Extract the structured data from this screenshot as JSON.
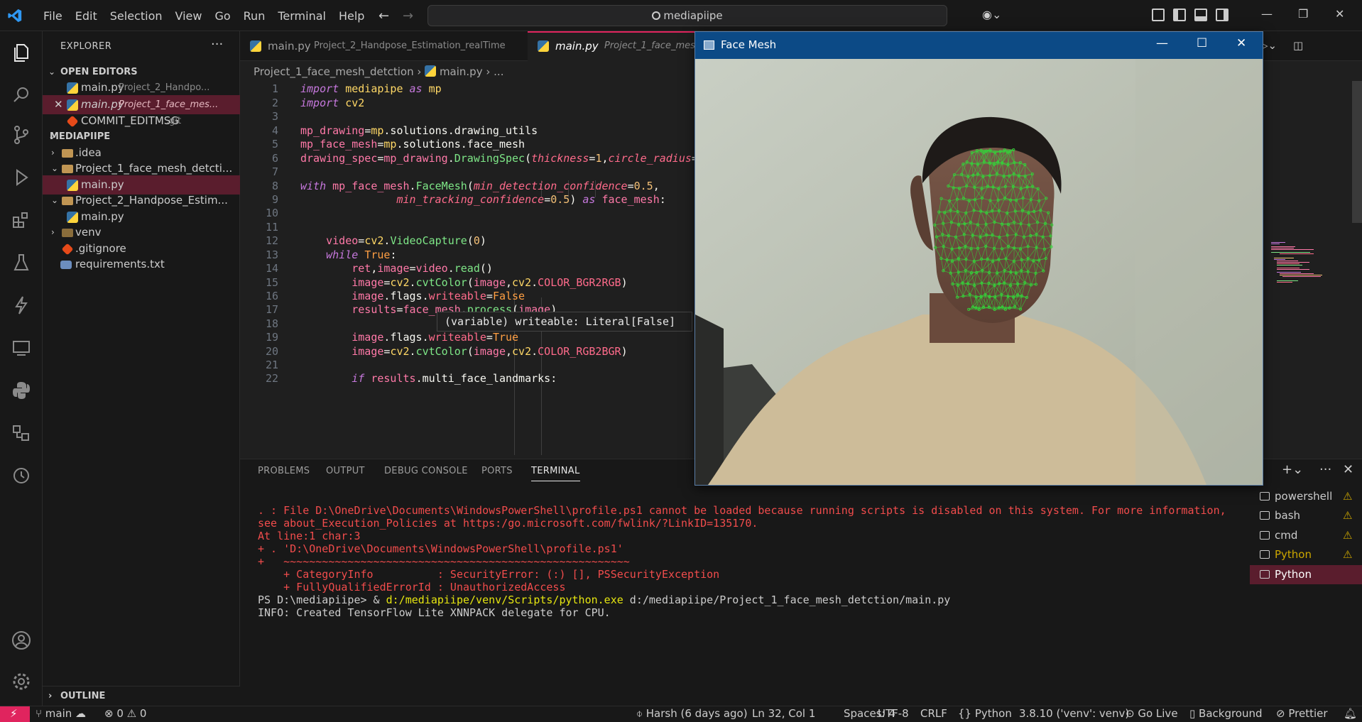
{
  "menu": [
    "File",
    "Edit",
    "Selection",
    "View",
    "Go",
    "Run",
    "Terminal",
    "Help"
  ],
  "search": {
    "text": "mediapiipe"
  },
  "sidebar": {
    "title": "EXPLORER",
    "open_editors_label": "OPEN EDITORS",
    "open_editors": [
      {
        "name": "main.py",
        "path": "Project_2_Handpo..."
      },
      {
        "name": "main.py",
        "path": "Project_1_face_mes..."
      },
      {
        "name": "COMMIT_EDITMSG",
        "path": ".git"
      }
    ],
    "workspace_label": "MEDIAPIIPE",
    "tree": [
      {
        "name": ".idea"
      },
      {
        "name": "Project_1_face_mesh_detcti..."
      },
      {
        "name": "main.py"
      },
      {
        "name": "Project_2_Handpose_Estim..."
      },
      {
        "name": "main.py"
      },
      {
        "name": "venv"
      },
      {
        "name": ".gitignore"
      },
      {
        "name": "requirements.txt"
      }
    ],
    "outline_label": "OUTLINE"
  },
  "tabs": [
    {
      "name": "main.py",
      "path": "Project_2_Handpose_Estimation_realTime"
    },
    {
      "name": "main.py",
      "path": "Project_1_face_mesh_"
    }
  ],
  "breadcrumb": {
    "folder": "Project_1_face_mesh_detction",
    "file": "main.py",
    "rest": "..."
  },
  "code": {
    "line_numbers": [
      "1",
      "2",
      "3",
      "4",
      "5",
      "6",
      "7",
      "8",
      "9",
      "10",
      "11",
      "12",
      "13",
      "14",
      "15",
      "16",
      "17",
      "18",
      "19",
      "20",
      "21",
      "22"
    ]
  },
  "hover": {
    "text": "(variable) writeable: Literal[False]"
  },
  "panel": {
    "tabs": [
      "PROBLEMS",
      "OUTPUT",
      "DEBUG CONSOLE",
      "PORTS",
      "TERMINAL"
    ],
    "terminal_lines": [
      ". : File D:\\OneDrive\\Documents\\WindowsPowerShell\\profile.ps1 cannot be loaded because running scripts is disabled on this system. For more information,",
      "see about_Execution_Policies at https:/go.microsoft.com/fwlink/?LinkID=135170.",
      "At line:1 char:3",
      "+ . 'D:\\OneDrive\\Documents\\WindowsPowerShell\\profile.ps1'",
      "+   ~~~~~~~~~~~~~~~~~~~~~~~~~~~~~~~~~~~~~~~~~~~~~~~~~~~~~~",
      "    + CategoryInfo          : SecurityError: (:) [], PSSecurityException",
      "    + FullyQualifiedErrorId : UnauthorizedAccess"
    ],
    "prompt": "PS D:\\mediapiipe> & ",
    "command_exe": "d:/mediapiipe/venv/Scripts/python.exe",
    "command_arg": " d:/mediapiipe/Project_1_face_mesh_detction/main.py",
    "info_line": "INFO: Created TensorFlow Lite XNNPACK delegate for CPU.",
    "terminals": [
      "powershell",
      "bash",
      "cmd",
      "Python",
      "Python"
    ]
  },
  "status": {
    "branch": "main",
    "errors": "0",
    "warnings": "0",
    "blame": "Harsh (6 days ago)",
    "position": "Ln 32, Col 1",
    "spaces": "Spaces: 4",
    "encoding": "UTF-8",
    "eol": "CRLF",
    "language": "Python",
    "interpreter": "3.8.10 ('venv': venv)",
    "golive": "Go Live",
    "background": "Background",
    "prettier": "Prettier"
  },
  "facemesh_window": {
    "title": "Face Mesh"
  },
  "colors": {
    "accent": "#e0245e",
    "selection": "#5a1d2d",
    "window_title": "#0c4a86",
    "mesh": "#35d23a"
  }
}
